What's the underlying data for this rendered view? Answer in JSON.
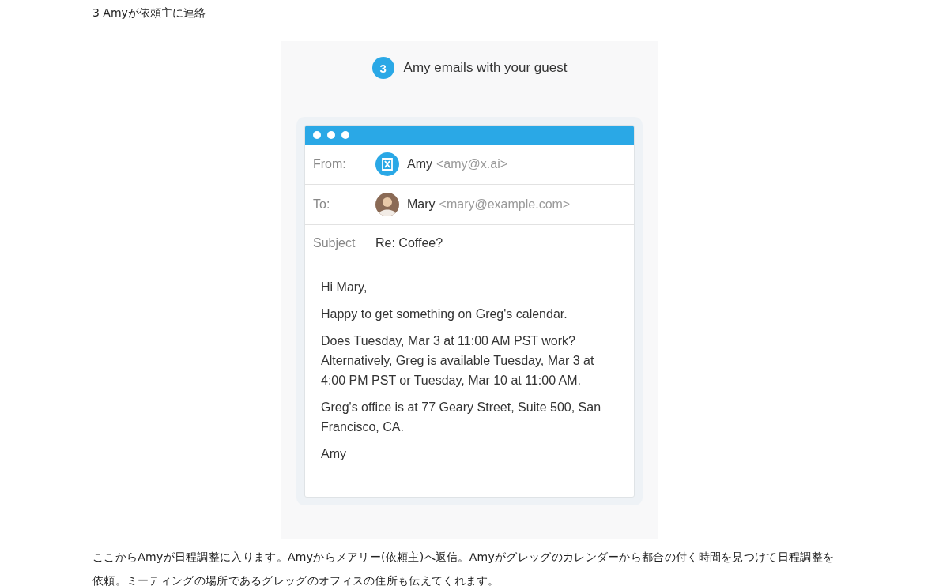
{
  "heading": "3 Amyが依頼主に連絡",
  "figure": {
    "step": "3",
    "title": "Amy emails with your guest",
    "email": {
      "header": [
        {
          "label": "From:",
          "kind": "logo",
          "name": "Amy",
          "address": "<amy@x.ai>"
        },
        {
          "label": "To:",
          "kind": "photo",
          "name": "Mary",
          "address": "<mary@example.com>"
        },
        {
          "label": "Subject",
          "kind": "text",
          "name": "Re: Coffee?"
        }
      ],
      "body": [
        "Hi Mary,",
        "Happy to get something on Greg's calendar.",
        "Does Tuesday, Mar 3 at 11:00 AM PST work? Alternatively, Greg is available Tuesday, Mar 3 at 4:00 PM PST or Tuesday, Mar 10 at 11:00 AM.",
        "Greg's office is at 77 Geary Street, Suite 500, San Francisco, CA.",
        "Amy"
      ]
    }
  },
  "paragraph": "ここからAmyが日程調整に入ります。Amyからメアリー(依頼主)へ返信。Amyがグレッグのカレンダーから都合の付く時間を見つけて日程調整を依頼。ミーティングの場所であるグレッグのオフィスの住所も伝えてくれます。"
}
